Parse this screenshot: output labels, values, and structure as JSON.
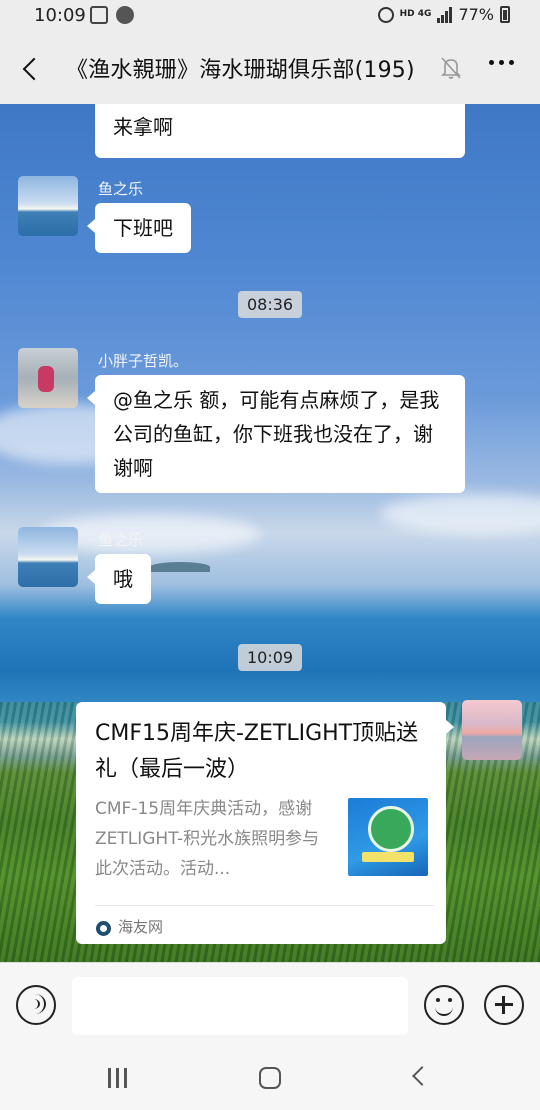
{
  "status_bar": {
    "time": "10:09",
    "network": "HD",
    "net_type": "4G",
    "battery": "77%"
  },
  "header": {
    "title": "《渔水親珊》海水珊瑚俱乐部(195)"
  },
  "messages": [
    {
      "text": "来拿啊"
    },
    {
      "sender": "鱼之乐",
      "text": "下班吧"
    },
    {
      "timestamp": "08:36"
    },
    {
      "sender": "小胖子哲凯。",
      "text": "@鱼之乐  额，可能有点麻烦了，是我公司的鱼缸，你下班我也没在了，谢谢啊"
    },
    {
      "sender": "鱼之乐",
      "text": "哦"
    },
    {
      "timestamp": "10:09"
    }
  ],
  "link_card": {
    "title": "CMF15周年庆-ZETLIGHT顶贴送礼（最后一波）",
    "description": "CMF-15周年庆典活动，感谢ZETLIGHT-积光水族照明参与此次活动。活动...",
    "source": "海友网"
  },
  "input_bar": {
    "placeholder": ""
  }
}
